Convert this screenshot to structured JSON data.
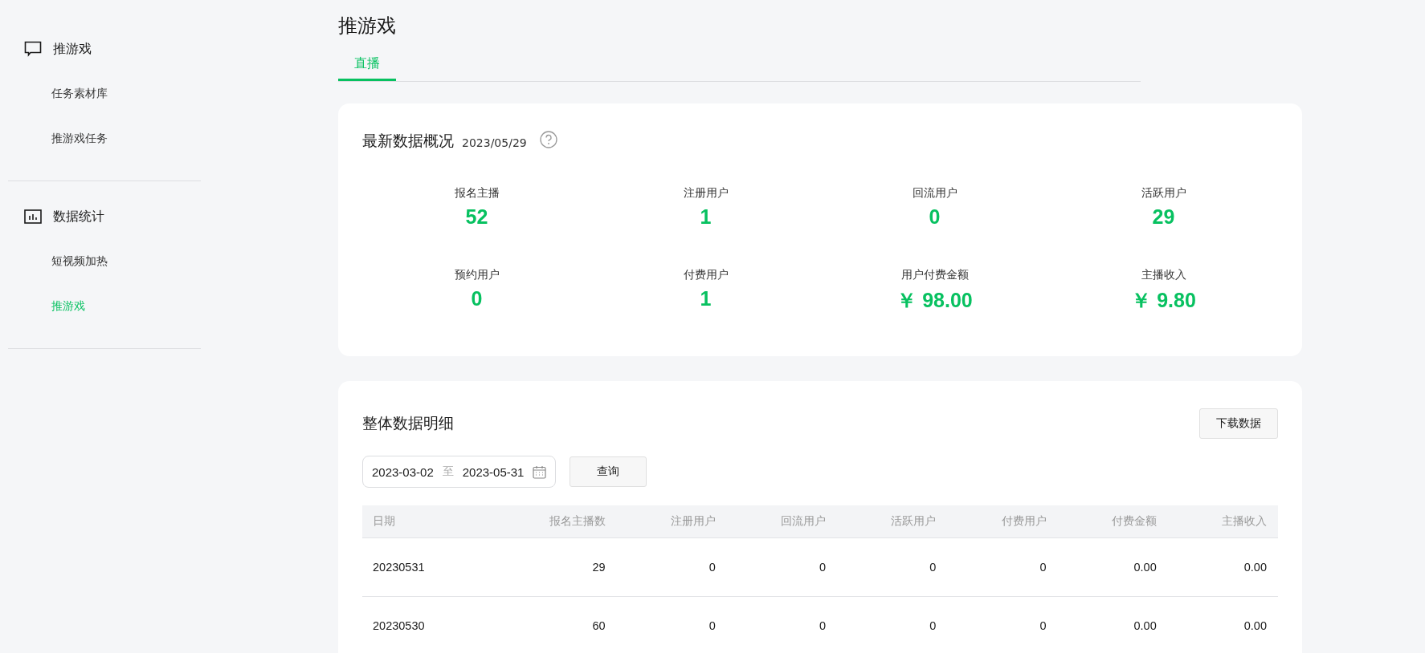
{
  "sidebar": {
    "groups": [
      {
        "label": "推游戏",
        "items": [
          {
            "label": "任务素材库",
            "selected": false
          },
          {
            "label": "推游戏任务",
            "selected": false
          }
        ]
      },
      {
        "label": "数据统计",
        "items": [
          {
            "label": "短视频加热",
            "selected": false
          },
          {
            "label": "推游戏",
            "selected": true
          }
        ]
      }
    ]
  },
  "page": {
    "title": "推游戏",
    "tabs": [
      {
        "label": "直播",
        "selected": true
      }
    ]
  },
  "overview": {
    "title": "最新数据概况",
    "date": "2023/05/29",
    "stats": [
      {
        "label": "报名主播",
        "value": "52"
      },
      {
        "label": "注册用户",
        "value": "1"
      },
      {
        "label": "回流用户",
        "value": "0"
      },
      {
        "label": "活跃用户",
        "value": "29"
      },
      {
        "label": "预约用户",
        "value": "0"
      },
      {
        "label": "付费用户",
        "value": "1"
      },
      {
        "label": "用户付费金额",
        "value": "￥ 98.00"
      },
      {
        "label": "主播收入",
        "value": "￥ 9.80"
      }
    ]
  },
  "detail": {
    "title": "整体数据明细",
    "download_button": "下载数据",
    "date_range": {
      "start": "2023-03-02",
      "separator": "至",
      "end": "2023-05-31"
    },
    "query_button": "查询",
    "table": {
      "columns": [
        "日期",
        "报名主播数",
        "注册用户",
        "回流用户",
        "活跃用户",
        "付费用户",
        "付费金额",
        "主播收入"
      ],
      "rows": [
        [
          "20230531",
          "29",
          "0",
          "0",
          "0",
          "0",
          "0.00",
          "0.00"
        ],
        [
          "20230530",
          "60",
          "0",
          "0",
          "0",
          "0",
          "0.00",
          "0.00"
        ]
      ]
    }
  }
}
